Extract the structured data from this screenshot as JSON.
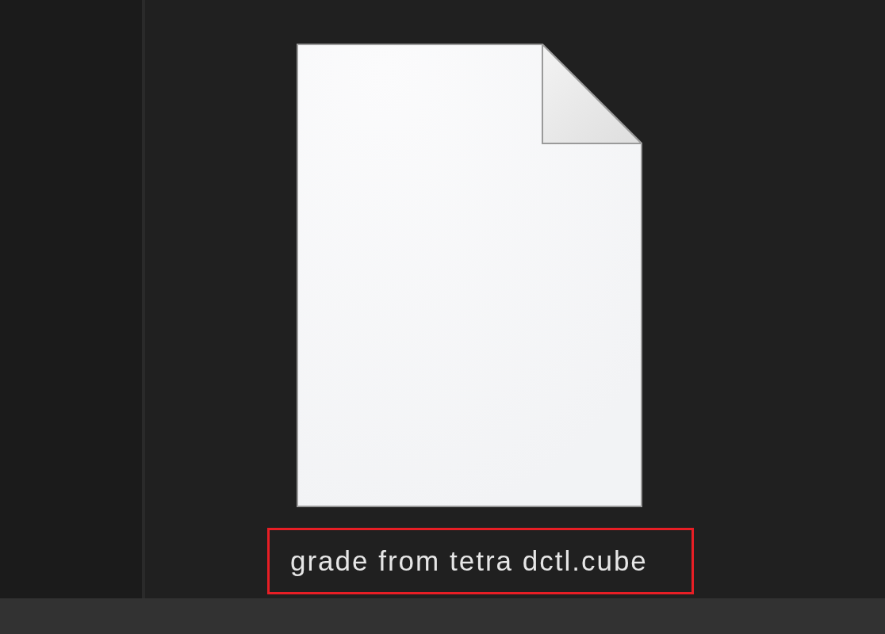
{
  "file": {
    "name": "grade from tetra dctl.cube",
    "highlighted": true
  }
}
